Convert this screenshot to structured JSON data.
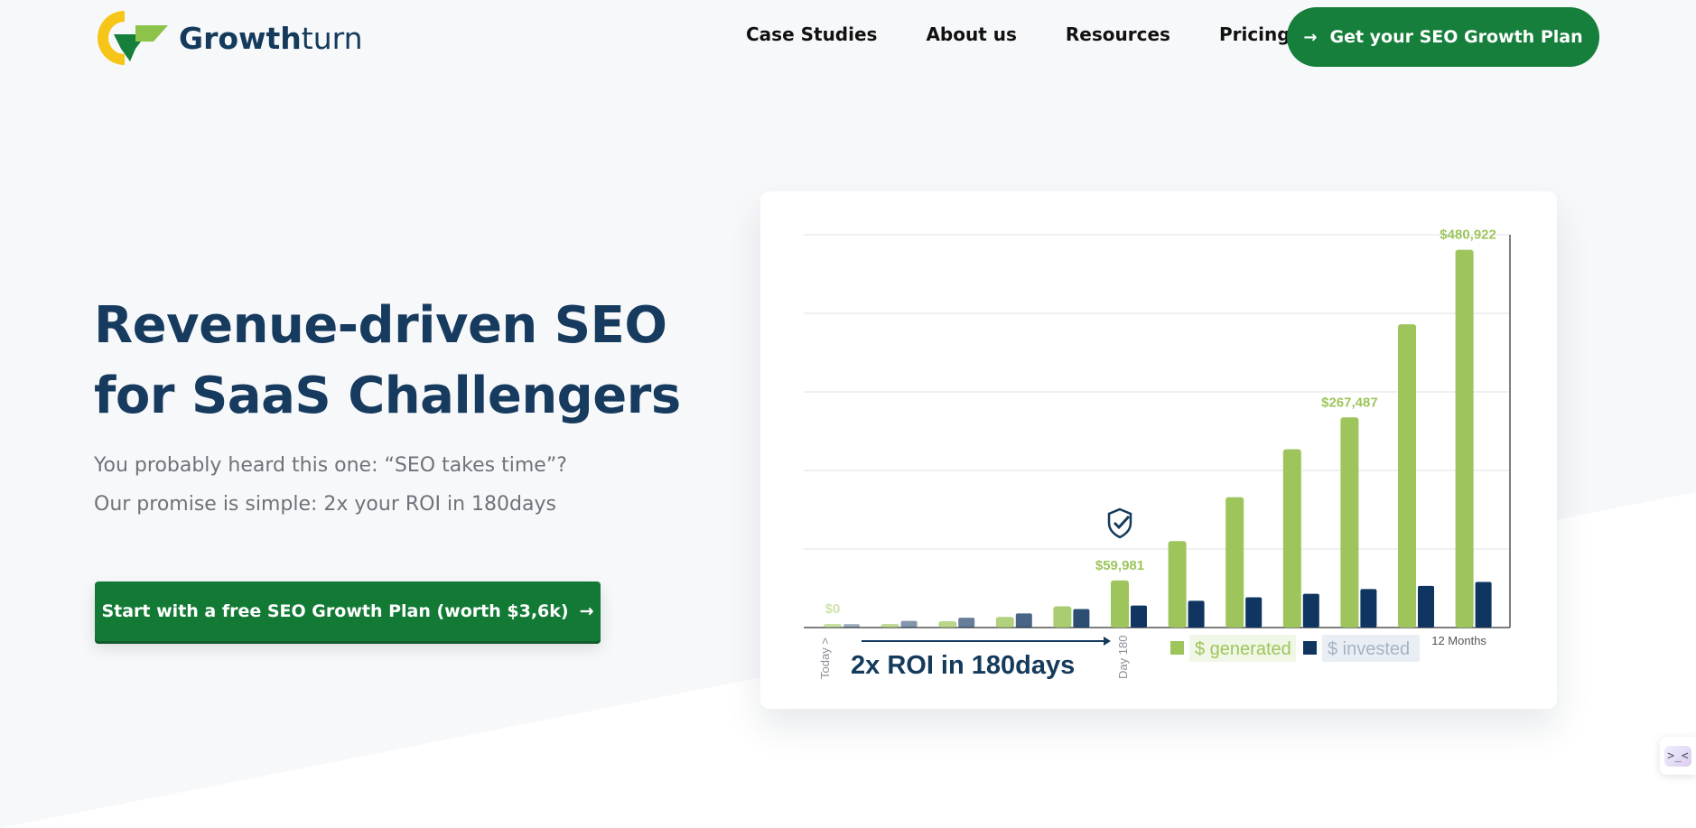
{
  "brand": {
    "name_bold": "Growth",
    "name_light": "turn",
    "colors": {
      "navy": "#143a5c",
      "green": "#157f3b",
      "yellow": "#f5c518",
      "light_green": "#8dc34a"
    }
  },
  "nav": {
    "items": [
      "Case Studies",
      "About us",
      "Resources",
      "Pricing"
    ],
    "cta_label": "Get your SEO Growth Plan",
    "cta_icon": "arrow-right-icon"
  },
  "hero": {
    "title_line1": "Revenue-driven SEO",
    "title_line2": "for SaaS Challengers",
    "subtitle_line1": "You probably heard this one: “SEO takes time”?",
    "subtitle_line2": "Our promise is simple: 2x your ROI in 180days",
    "cta_label": "Start with a free SEO Growth Plan (worth $3,6k)",
    "cta_icon": "arrow-right-icon"
  },
  "chart_data": {
    "type": "bar",
    "title": "2x ROI in 180days",
    "categories": [
      "Today >",
      "",
      "",
      "",
      "",
      "Day 180",
      "",
      "",
      "",
      "",
      "",
      "12 Months"
    ],
    "series": [
      {
        "name": "$ generated",
        "color": "#9dc55c",
        "values": [
          0,
          4000,
          8000,
          13500,
          27000,
          59981,
          110000,
          166000,
          227000,
          267487,
          386000,
          480922
        ]
      },
      {
        "name": "$ invested",
        "color": "#0f3560",
        "values": [
          4500,
          8500,
          12500,
          18000,
          23500,
          28000,
          34000,
          38500,
          43000,
          49000,
          53000,
          58000
        ]
      }
    ],
    "data_labels": [
      {
        "category_index": 0,
        "text": "$0"
      },
      {
        "category_index": 5,
        "text": "$59,981"
      },
      {
        "category_index": 9,
        "text": "$267,487"
      },
      {
        "category_index": 11,
        "text": "$480,922"
      }
    ],
    "ylim": [
      0,
      500000
    ],
    "grid": true,
    "legend_position": "bottom",
    "milestone_icon": "shield-check-icon"
  },
  "widget": {
    "glyph": ">_<"
  }
}
